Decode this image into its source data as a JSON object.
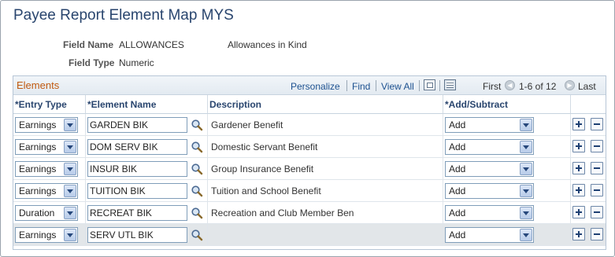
{
  "page": {
    "title": "Payee Report Element Map MYS"
  },
  "fields": {
    "field_name_label": "Field Name",
    "field_name_value": "ALLOWANCES",
    "field_name_desc": "Allowances in Kind",
    "field_type_label": "Field Type",
    "field_type_value": "Numeric"
  },
  "grid": {
    "title": "Elements",
    "toolbar": {
      "personalize": "Personalize",
      "find": "Find",
      "view_all": "View All",
      "first": "First",
      "range": "1-6 of 12",
      "last": "Last"
    },
    "columns": {
      "entry_type": "*Entry Type",
      "element_name": "*Element Name",
      "description": "Description",
      "add_subtract": "*Add/Subtract"
    },
    "rows": [
      {
        "entry_type": "Earnings",
        "element_name": "GARDEN BIK",
        "description": "Gardener Benefit",
        "add_subtract": "Add"
      },
      {
        "entry_type": "Earnings",
        "element_name": "DOM SERV BIK",
        "description": "Domestic Servant Benefit",
        "add_subtract": "Add"
      },
      {
        "entry_type": "Earnings",
        "element_name": "INSUR BIK",
        "description": "Group Insurance Benefit",
        "add_subtract": "Add"
      },
      {
        "entry_type": "Earnings",
        "element_name": "TUITION BIK",
        "description": "Tuition and School Benefit",
        "add_subtract": "Add"
      },
      {
        "entry_type": "Duration",
        "element_name": "RECREAT BIK",
        "description": "Recreation and Club Member Ben",
        "add_subtract": "Add"
      },
      {
        "entry_type": "Earnings",
        "element_name": "SERV UTL BIK",
        "description": "",
        "add_subtract": "Add"
      }
    ]
  },
  "icons": {
    "lookup": "magnifier-icon",
    "add_row": "plus-icon",
    "delete_row": "minus-icon",
    "view_all": "zoom-grid-icon",
    "download": "download-grid-icon",
    "prev": "prev-arrow-icon",
    "next": "next-arrow-icon"
  },
  "colors": {
    "title": "#29456e",
    "grid_title": "#c05a10",
    "link": "#1d5190",
    "shaded_row": "#e2e6e9"
  }
}
